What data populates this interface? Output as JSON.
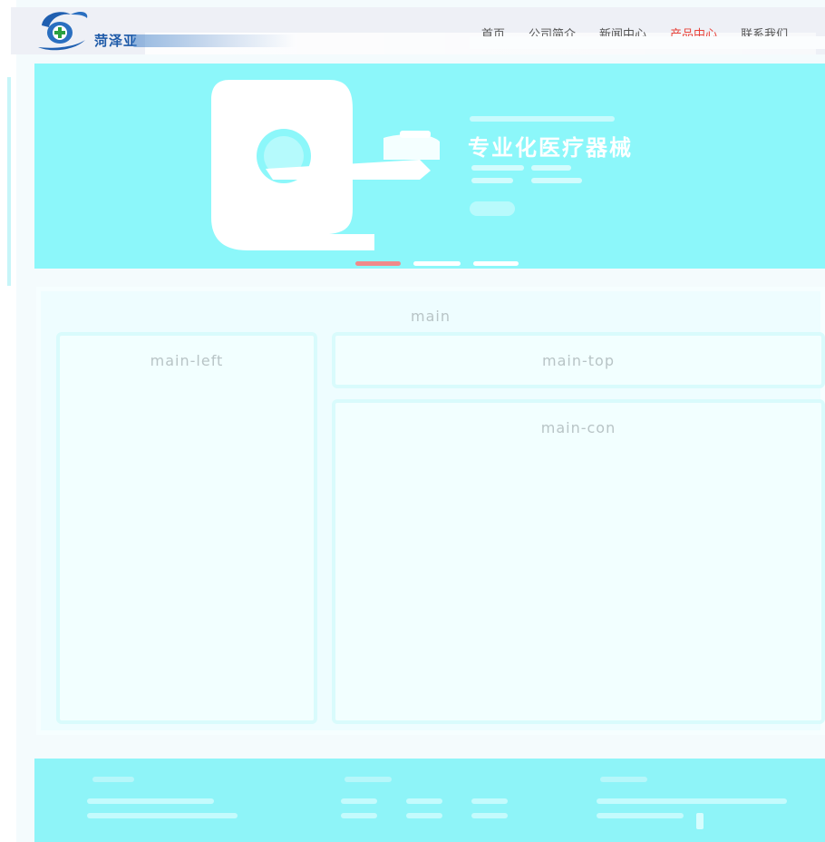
{
  "header": {
    "logo_text": "菏泽亚",
    "nav": [
      "首页",
      "公司简介",
      "新闻中心",
      "产品中心",
      "联系我们"
    ],
    "active_nav_index": 3
  },
  "banner": {
    "title": "专业化医疗器械",
    "slides_count": 3,
    "active_slide": 1
  },
  "main": {
    "label": "main",
    "left_label": "main-left",
    "top_label": "main-top",
    "con_label": "main-con"
  },
  "colors": {
    "accent": "#e8433a",
    "banner_bg": "#8cf7fa",
    "footer_bg": "#8ef4f8",
    "logo_blue": "#1e5aa8"
  }
}
